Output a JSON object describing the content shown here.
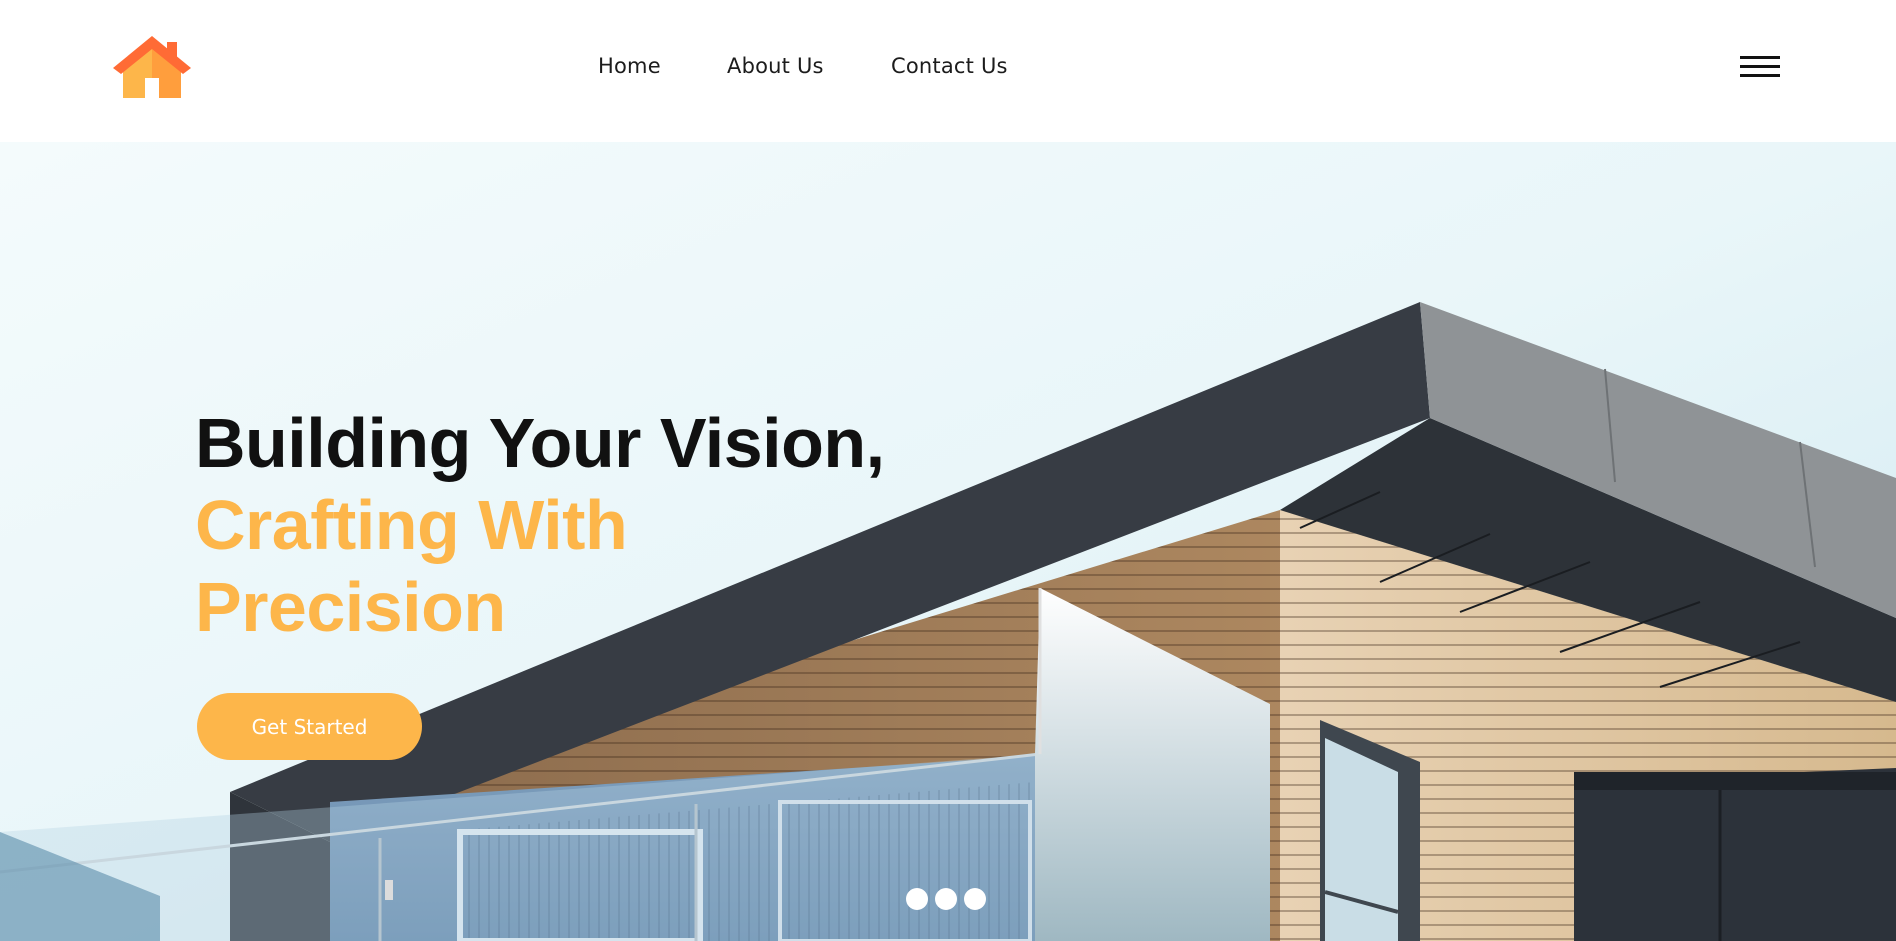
{
  "header": {
    "logo_icon": "house-icon",
    "nav": [
      {
        "label": "Home"
      },
      {
        "label": "About Us"
      },
      {
        "label": "Contact Us"
      }
    ],
    "menu_icon": "hamburger-menu-icon"
  },
  "hero": {
    "title_line1": "Building Your Vision,",
    "title_line2": "Crafting With",
    "title_line3": "Precision",
    "cta_label": "Get Started",
    "slides_count": 3
  },
  "colors": {
    "accent": "#fdb64a",
    "logo_roof": "#ff6b35",
    "text_dark": "#111111"
  }
}
